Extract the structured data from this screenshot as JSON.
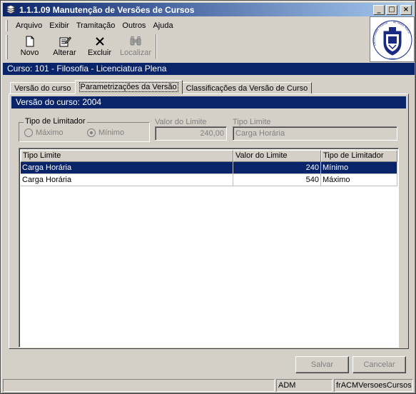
{
  "window": {
    "title": "1.1.1.09 Manutenção de Versões de Cursos",
    "minimize_glyph": "_",
    "maximize_glyph": "□",
    "close_glyph": "×"
  },
  "menu": [
    {
      "label": "Arquivo"
    },
    {
      "label": "Exibir"
    },
    {
      "label": "Tramitação"
    },
    {
      "label": "Outros"
    },
    {
      "label": "Ajuda"
    }
  ],
  "toolbar": {
    "novo": "Novo",
    "alterar": "Alterar",
    "excluir": "Excluir",
    "localizar": "Localizar"
  },
  "logo": {
    "text": "Universidade Federal de Santa Maria",
    "year": "1960",
    "icon": "university-seal-icon"
  },
  "course_bar": "Curso: 101 - Filosofia - Licenciatura Plena",
  "tabs": [
    {
      "label": "Versão do curso"
    },
    {
      "label": "Parametrizações da Versão"
    },
    {
      "label": "Classificações da Versão de Curso"
    }
  ],
  "version_bar": "Versão do curso: 2004",
  "limit_type_group": {
    "legend": "Tipo de Limitador",
    "option_max": "Máximo",
    "option_min": "Mínimo",
    "selected": "Mínimo"
  },
  "limit_value": {
    "label": "Valor do Limite",
    "value": "240,00"
  },
  "limit_kind": {
    "label": "Tipo Limite",
    "value": "Carga Horária"
  },
  "grid": {
    "columns": [
      "Tipo Limite",
      "Valor do Limite",
      "Tipo de Limitador"
    ],
    "rows": [
      {
        "tipo": "Carga Horária",
        "valor": "240",
        "limitador": "Mínimo"
      },
      {
        "tipo": "Carga Horária",
        "valor": "540",
        "limitador": "Máximo"
      }
    ]
  },
  "buttons": {
    "save": "Salvar",
    "cancel": "Cancelar"
  },
  "status": {
    "user": "ADM",
    "form": "frACMVersoesCursos"
  }
}
